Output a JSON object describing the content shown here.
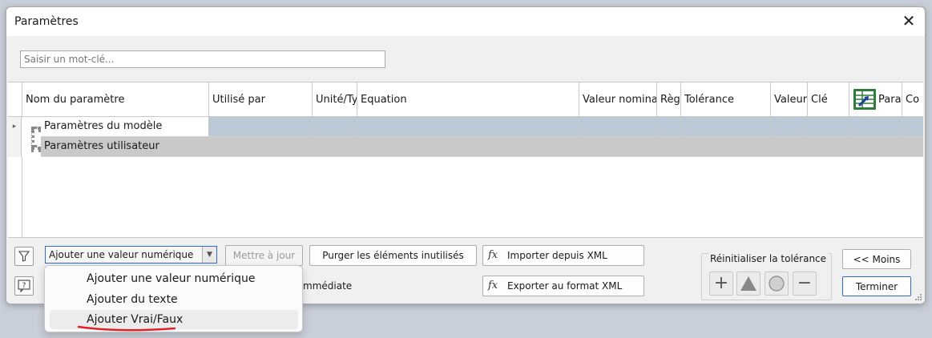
{
  "window": {
    "title": "Paramètres",
    "close": "✕"
  },
  "search": {
    "placeholder": "Saisir un mot-clé..."
  },
  "grid": {
    "columns": [
      "Nom du paramètre",
      "Utilisé par",
      "Unité/Ty",
      "Equation",
      "Valeur nominal",
      "Règ",
      "Tolérance",
      "Valeur",
      "Clé",
      "Para",
      "Co"
    ],
    "rows": [
      {
        "expander": "▸",
        "name": "Paramètres du modèle"
      },
      {
        "expander": "",
        "name": "Paramètres utilisateur"
      }
    ]
  },
  "toolbar": {
    "combo_value": "Ajouter une valeur numérique",
    "combo_arrow": "▼",
    "update_label": "Mettre à jour",
    "purge_label": "Purger les éléments inutilisés",
    "import_label": "Importer depuis XML",
    "export_label": "Exporter au format XML",
    "immediate_partial": "mmédiate",
    "fx_glyph": "fx",
    "filter_glyph": "⛉",
    "help_glyph": "?"
  },
  "tolerance": {
    "label": "Réinitialiser la tolérance",
    "plus": "+",
    "minus": "−"
  },
  "actions": {
    "less_label": "<< Moins",
    "finish_label": "Terminer"
  },
  "dropdown": {
    "items": [
      "Ajouter une valeur numérique",
      "Ajouter du texte",
      "Ajouter Vrai/Faux"
    ]
  },
  "colors": {
    "accent": "#2f6cc9",
    "row_model": "#bcc9d6",
    "row_user": "#c9c9c9",
    "annotation_underline": "#e0202a"
  }
}
